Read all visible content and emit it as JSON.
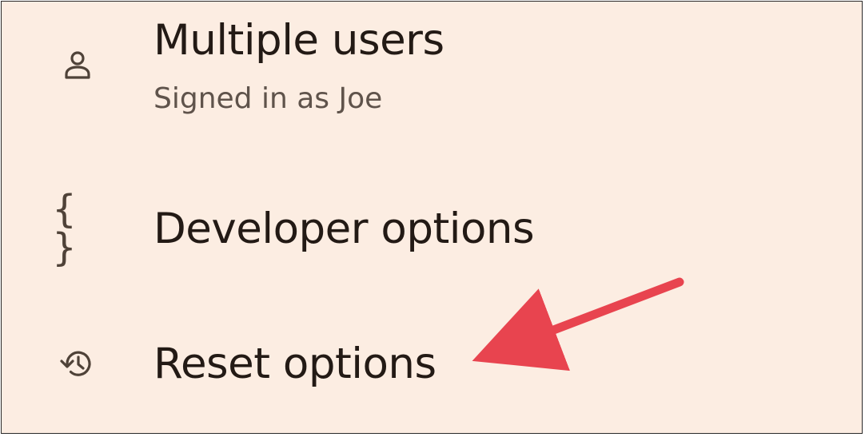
{
  "settings": {
    "items": [
      {
        "icon": "person-icon",
        "title": "Multiple users",
        "subtitle": "Signed in as Joe"
      },
      {
        "icon": "braces-icon",
        "title": "Developer options",
        "icon_text": "{ }"
      },
      {
        "icon": "history-icon",
        "title": "Reset options"
      }
    ]
  },
  "annotation": {
    "arrow_color": "#e8444f",
    "target": "Reset options"
  },
  "colors": {
    "background": "#fcede2",
    "title": "#231a15",
    "subtitle": "#5f534b",
    "icon": "#4f4238"
  }
}
